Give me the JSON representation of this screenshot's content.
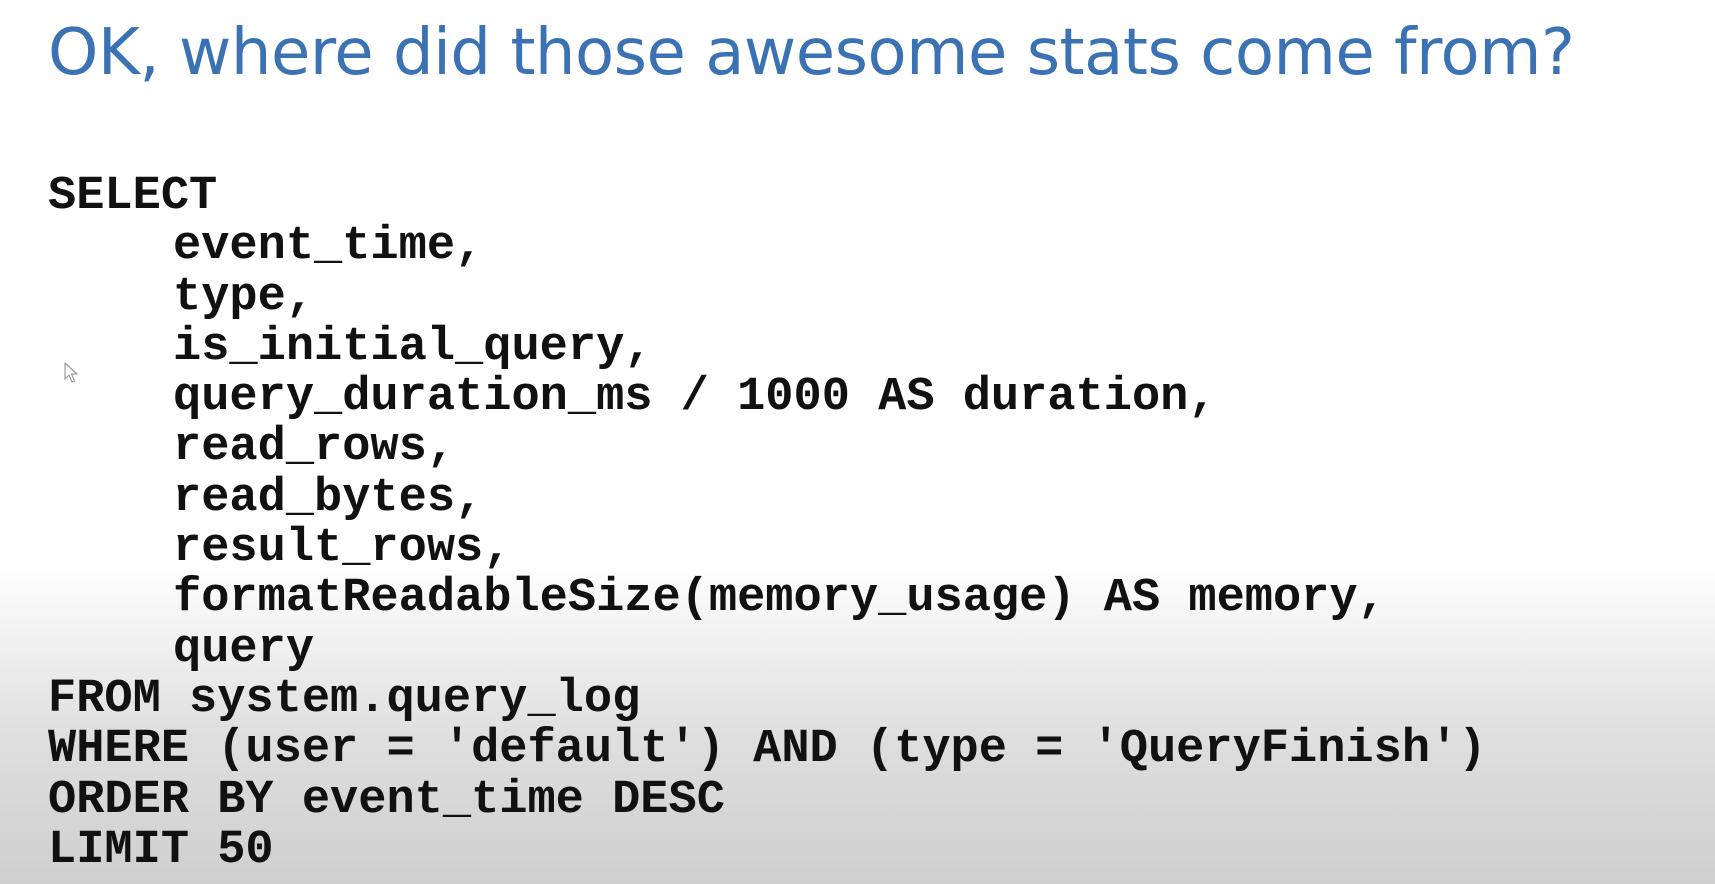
{
  "slide": {
    "title": "OK, where did those awesome stats come from?"
  },
  "code": {
    "lines": [
      "SELECT",
      "event_time,",
      "type,",
      "is_initial_query,",
      "query_duration_ms / 1000 AS duration,",
      "read_rows,",
      "read_bytes,",
      "result_rows,",
      "formatReadableSize(memory_usage) AS memory,",
      "query",
      "FROM system.query_log",
      "WHERE (user = 'default') AND (type = 'QueryFinish')",
      "ORDER BY event_time DESC",
      "LIMIT 50"
    ]
  },
  "icons": {
    "cursor": "mouse-pointer-icon"
  }
}
